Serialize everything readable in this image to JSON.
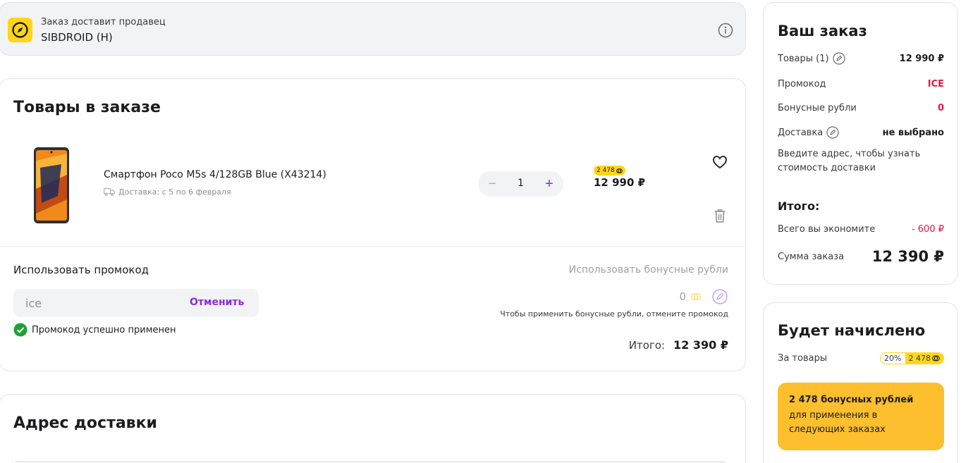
{
  "seller": {
    "caption": "Заказ доставит продавец",
    "name": "SIBDROID (H)"
  },
  "goods": {
    "title": "Товары в заказе",
    "item": {
      "name": "Смартфон Poco M5s 4/128GB Blue (X43214)",
      "delivery": "Доставка: с 5 по 6 февраля",
      "quantity": "1",
      "bonus_badge": "2 478",
      "price": "12 990 ₽"
    },
    "promo": {
      "label": "Использовать промокод",
      "value": "ice",
      "cancel_label": "Отменить",
      "success": "Промокод успешно применен"
    },
    "bonus": {
      "label": "Использовать бонусные рубли",
      "amount": "0",
      "hint": "Чтобы применить бонусные рубли, отмените промокод"
    },
    "total_label": "Итого:",
    "total_value": "12 390 ₽"
  },
  "address": {
    "title": "Адрес доставки"
  },
  "order": {
    "title": "Ваш заказ",
    "goods_label": "Товары (1)",
    "goods_value": "12 990 ₽",
    "promo_label": "Промокод",
    "promo_value": "ICE",
    "bonus_label": "Бонусные рубли",
    "bonus_value": "0",
    "delivery_label": "Доставка",
    "delivery_value": "не выбрано",
    "delivery_hint": "Введите адрес, чтобы узнать стоимость доставки",
    "itogo": "Итого:",
    "savings_label": "Всего вы экономите",
    "savings_value": "- 600 ₽",
    "sum_label": "Сумма заказа",
    "sum_value": "12 390 ₽"
  },
  "accrual": {
    "title": "Будет начислено",
    "for_goods_label": "За товары",
    "percent": "20%",
    "amount": "2 478",
    "box_title": "2 478 бонусных рублей",
    "box_sub": "для применения в следующих заказах"
  },
  "colors": {
    "accent_purple": "#8a2be2",
    "bonus_yellow": "#ffd617",
    "promo_red": "#e3183d",
    "success_green": "#21a038"
  }
}
